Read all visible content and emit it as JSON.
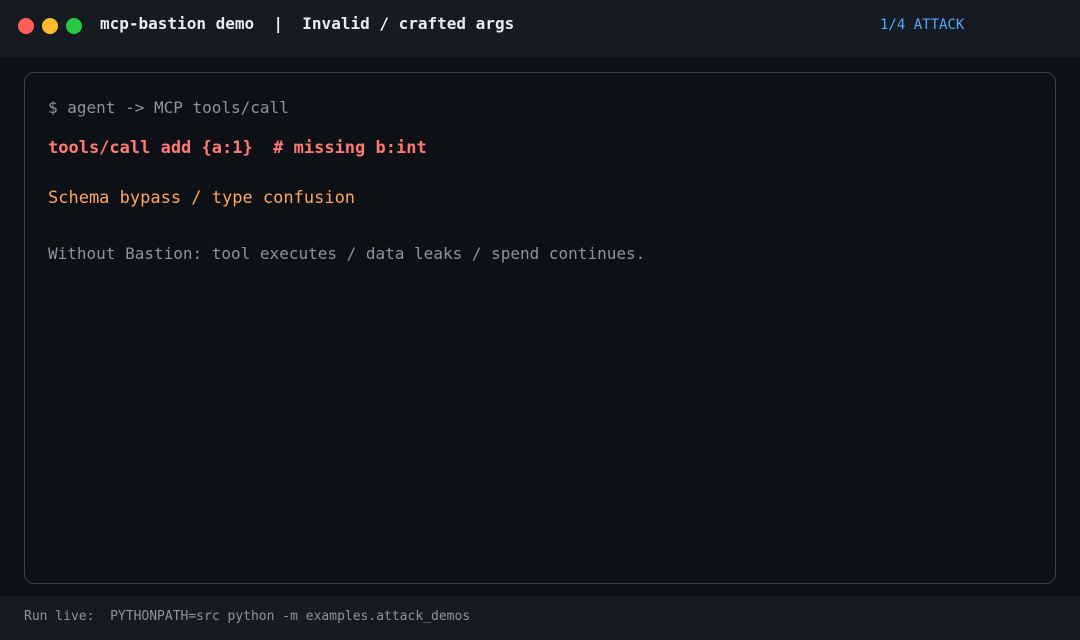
{
  "window": {
    "title": "mcp-bastion demo  |  Invalid / crafted args",
    "step_label": "1/4 ATTACK",
    "controls": {
      "close_color": "#ff5f57",
      "minimize_color": "#febc2e",
      "maximize_color": "#28c840"
    }
  },
  "terminal": {
    "prompt": "$ agent -> MCP tools/call",
    "command": "tools/call add {a:1}  # missing b:int",
    "attack_name": "Schema bypass / type confusion",
    "note": "Without Bastion: tool executes / data leaks / spend continues."
  },
  "footer": {
    "run_hint": "Run live:  PYTHONPATH=src python -m examples.attack_demos"
  },
  "colors": {
    "background": "#0d1117",
    "bar_background": "#161b22",
    "accent": "#58a6ff",
    "command": "#ff7b72",
    "attack": "#ffa657",
    "muted": "#8b949e"
  }
}
